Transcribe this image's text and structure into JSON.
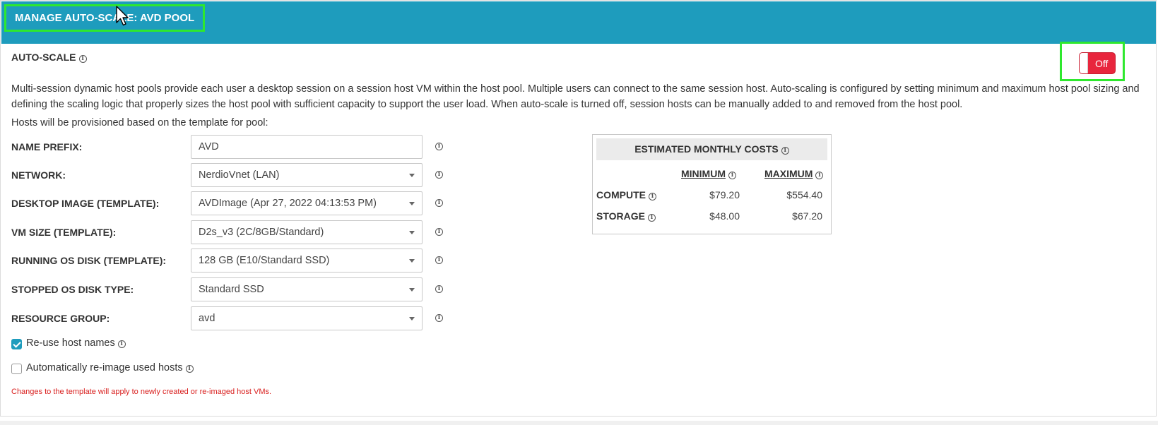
{
  "header": {
    "title": "MANAGE AUTO-SCALE: AVD POOL"
  },
  "autoscale": {
    "label": "AUTO-SCALE",
    "toggle_state": "Off",
    "toggle_color": "#e8263d"
  },
  "description": "Multi-session dynamic host pools provide each user a desktop session on a session host VM within the host pool. Multiple users can connect to the same session host. Auto-scaling is configured by setting minimum and maximum host pool sizing and defining the scaling logic that properly sizes the host pool with sufficient capacity to support the user load. When auto-scale is turned off, session hosts can be manually added to and removed from the host pool.",
  "provision_note": "Hosts will be provisioned based on the template for pool:",
  "fields": [
    {
      "label": "NAME PREFIX:",
      "value": "AVD",
      "type": "text"
    },
    {
      "label": "NETWORK:",
      "value": "NerdioVnet (LAN)",
      "type": "select"
    },
    {
      "label": "DESKTOP IMAGE (TEMPLATE):",
      "value": "AVDImage (Apr 27, 2022 04:13:53 PM)",
      "type": "select"
    },
    {
      "label": "VM SIZE (TEMPLATE):",
      "value": "D2s_v3 (2C/8GB/Standard)",
      "type": "select"
    },
    {
      "label": "RUNNING OS DISK (TEMPLATE):",
      "value": "128 GB (E10/Standard SSD)",
      "type": "select"
    },
    {
      "label": "STOPPED OS DISK TYPE:",
      "value": "Standard SSD",
      "type": "select"
    },
    {
      "label": "RESOURCE GROUP:",
      "value": "avd",
      "type": "select"
    }
  ],
  "checkboxes": [
    {
      "label": "Re-use host names",
      "checked": true
    },
    {
      "label": "Automatically re-image used hosts",
      "checked": false
    }
  ],
  "warning": "Changes to the template will apply to newly created or re-imaged host VMs.",
  "costs": {
    "title": "ESTIMATED MONTHLY COSTS",
    "col_min": "MINIMUM",
    "col_max": "MAXIMUM",
    "rows": [
      {
        "label": "COMPUTE",
        "min": "$79.20",
        "max": "$554.40"
      },
      {
        "label": "STORAGE",
        "min": "$48.00",
        "max": "$67.20"
      }
    ]
  },
  "colors": {
    "header_bg": "#1e9cbd",
    "highlight": "#2ee82e",
    "warning": "#d9201f"
  },
  "icons": {
    "info": "info-circle-icon",
    "dropdown": "chevron-down-icon",
    "cursor": "mouse-pointer-icon"
  }
}
